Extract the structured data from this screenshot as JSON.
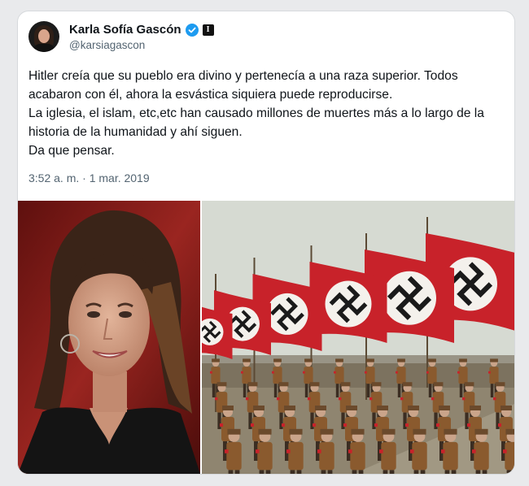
{
  "post": {
    "author_name": "Karla Sofía Gascón",
    "handle": "@karsiagascon",
    "badge_letter": "I",
    "text_lines": [
      "Hitler creía que su pueblo era divino y pertenecía a una raza superior. Todos",
      "acabaron con él, ahora la esvástica siquiera puede reproducirse.",
      "La iglesia, el islam, etc,etc han causado millones de muertes más a lo largo de la",
      "historia de la humanidad y ahí siguen.",
      "Da que pensar."
    ],
    "timestamp": "3:52 a. m. · 1 mar. 2019"
  },
  "colors": {
    "verified": "#1d9bf0",
    "flag_red": "#c8222a",
    "text": "#0f1419",
    "muted": "#536471"
  },
  "icons": {
    "verified": "verified-badge-icon",
    "affiliation": "affiliation-badge-icon"
  }
}
